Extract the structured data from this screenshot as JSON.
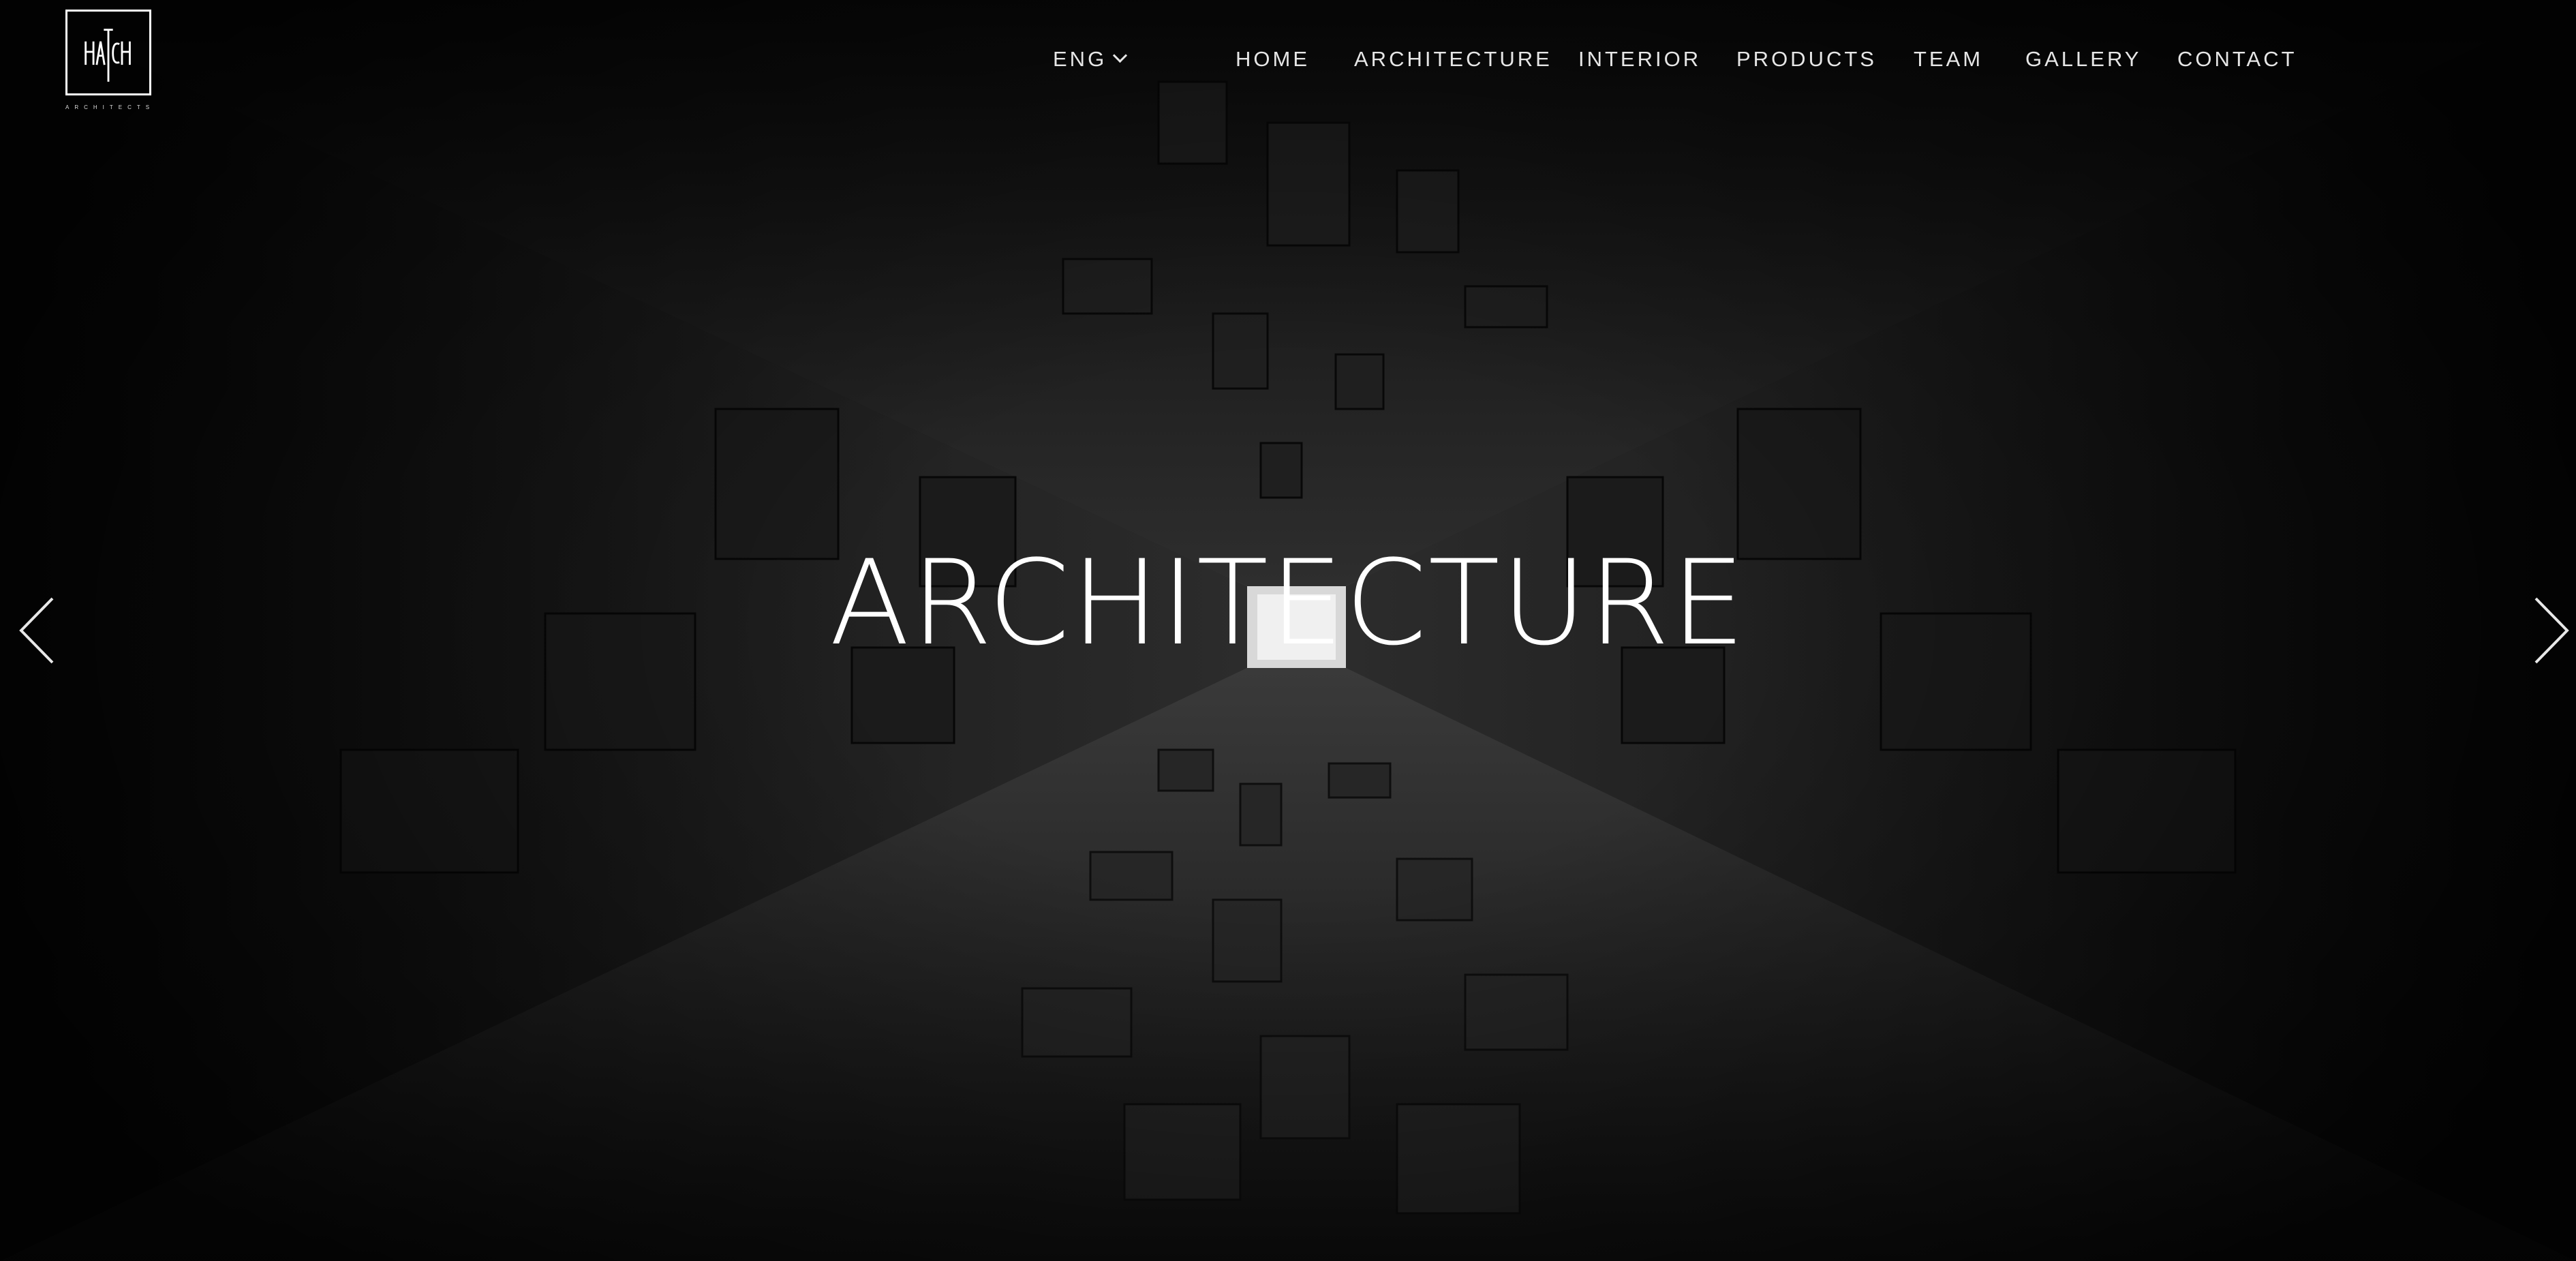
{
  "brand": {
    "logo_text": "HATCH",
    "logo_subtext": "ARCHITECTS"
  },
  "language": {
    "selected": "ENG"
  },
  "nav": {
    "items": [
      {
        "label": "HOME"
      },
      {
        "label": "ARCHITECTURE"
      },
      {
        "label": "INTERIOR"
      },
      {
        "label": "PRODUCTS"
      },
      {
        "label": "TEAM"
      },
      {
        "label": "GALLERY"
      },
      {
        "label": "CONTACT"
      }
    ]
  },
  "hero": {
    "title": "ARCHITECTURE",
    "prev_icon": "chevron-left-icon",
    "next_icon": "chevron-right-icon"
  },
  "colors": {
    "background": "#000000",
    "text": "#ffffff",
    "nav_text": "#e6e6e6"
  }
}
